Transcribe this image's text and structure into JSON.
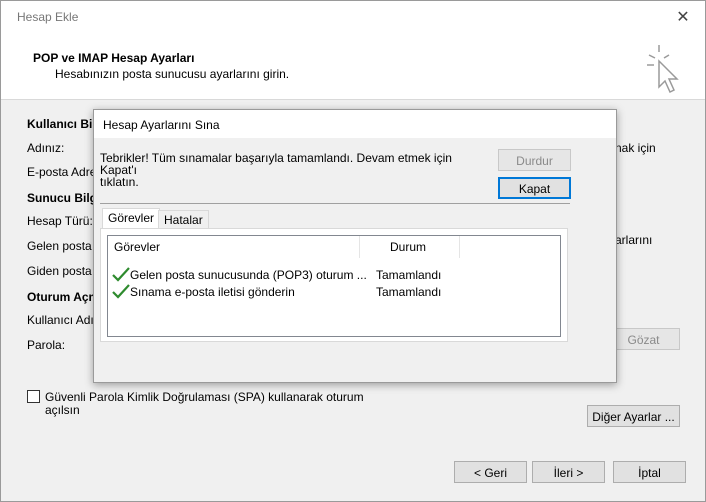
{
  "window": {
    "title": "Hesap Ekle",
    "close_glyph": "✕",
    "header_title": "POP ve IMAP Hesap Ayarları",
    "header_subtitle": "Hesabınızın posta sunucusu ayarlarını girin."
  },
  "background_form": {
    "user_info": "Kullanıcı Bilg",
    "name": "Adınız:",
    "email": "E-posta Adre",
    "server_info": "Sunucu Bilgi",
    "account_type": "Hesap Türü:",
    "incoming": "Gelen posta",
    "outgoing": "Giden posta",
    "logon": "Oturum Açm",
    "username": "Kullanıcı Adı:",
    "password": "Parola:",
    "right_text_1": "nak için",
    "right_text_2": "arlarını",
    "browse_label": "Gözat",
    "spa_line1": "Güvenli Parola Kimlik Doğrulaması (SPA) kullanarak oturum",
    "spa_line2": "açılsın",
    "more_settings": "Diğer Ayarlar ...",
    "back": "< Geri",
    "next": "İleri >",
    "cancel": "İptal"
  },
  "dialog": {
    "title": "Hesap Ayarlarını Sına",
    "message_line1": "Tebrikler! Tüm sınamalar başarıyla tamamlandı. Devam etmek için Kapat'ı",
    "message_line2": "tıklatın.",
    "stop_label": "Durdur",
    "close_label": "Kapat",
    "tabs": [
      {
        "label": "Görevler",
        "active": true
      },
      {
        "label": "Hatalar",
        "active": false
      }
    ],
    "columns": [
      "Görevler",
      "Durum"
    ],
    "rows": [
      {
        "task": "Gelen posta sunucusunda (POP3) oturum ...",
        "status": "Tamamlandı",
        "icon": "checkmark-icon"
      },
      {
        "task": "Sınama e-posta iletisi gönderin",
        "status": "Tamamlandı",
        "icon": "checkmark-icon"
      }
    ],
    "check_color": "#2e8b2e"
  }
}
